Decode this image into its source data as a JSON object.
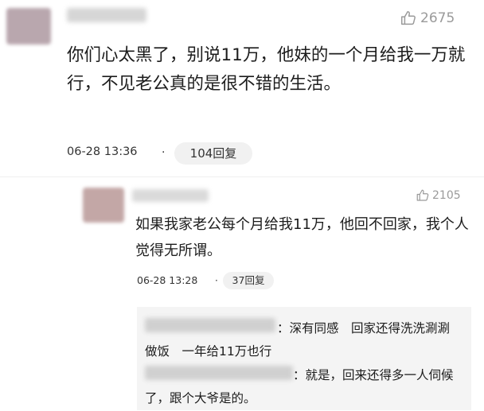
{
  "comment": {
    "likes": "2675",
    "text": "你们心太黑了，别说11万，他妹的一个月给我一万就行，不见老公真的是很不错的生活。",
    "time": "06-28 13:36",
    "separator": "·",
    "reply_label": "104回复",
    "reply": {
      "likes": "2105",
      "text": "如果我家老公每个月给我11万，他回不回家，我个人觉得无所谓。",
      "time": "06-28 13:28",
      "separator": "·",
      "reply_label": "37回复",
      "sub_replies": [
        {
          "text": "：深有同感　回家还得洗洗涮涮　做饭　一年给11万也行"
        },
        {
          "text": "：就是，回来还得多一人伺候了，跟个大爷是的。"
        }
      ]
    }
  },
  "colors": {
    "like_gray": "#9a9a9a",
    "button_bg": "#f1f1f1",
    "subbox_bg": "#f4f4f4"
  },
  "icons": {
    "like": "thumbs-up-icon"
  }
}
